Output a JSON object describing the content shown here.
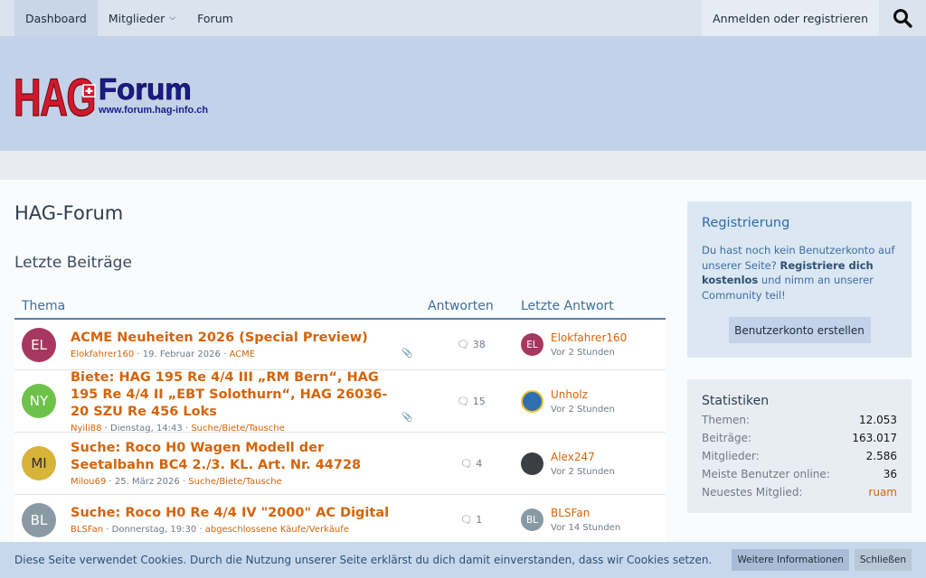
{
  "nav": {
    "items": [
      {
        "label": "Dashboard"
      },
      {
        "label": "Mitglieder"
      },
      {
        "label": "Forum"
      }
    ],
    "login_label": "Anmelden oder registrieren",
    "search_icon": "search-icon"
  },
  "logo": {
    "letters": "HAG",
    "word": "Forum",
    "url": "www.forum.hag-info.ch"
  },
  "page_title": "HAG-Forum",
  "section_title": "Letzte Beiträge",
  "table": {
    "col_thema": "Thema",
    "col_antworten": "Antworten",
    "col_letzte": "Letzte Antwort",
    "rows": [
      {
        "avatar": "EL",
        "avatar_color": "#a8375f",
        "title": "ACME Neuheiten 2026 (Special Preview)",
        "author": "Elokfahrer160",
        "date": "19. Februar 2026",
        "category": "ACME",
        "replies": "38",
        "last_avatar": "EL",
        "last_avatar_color": "#a8375f",
        "last_user": "Elokfahrer160",
        "last_time": "Vor 2 Stunden"
      },
      {
        "avatar": "NY",
        "avatar_color": "#6ec24a",
        "title": "Biete: HAG 195 Re 4/4 III „RM Bern“, HAG 195 Re 4/4 II „EBT Solothurn“, HAG 26036-20 SZU Re 456 Loks",
        "author": "Nyili88",
        "date": "Dienstag, 14:43",
        "category": "Suche/Biete/Tausche",
        "replies": "15",
        "last_avatar": "",
        "last_avatar_color": "#2e6fb0",
        "last_user": "Unholz",
        "last_time": "Vor 2 Stunden"
      },
      {
        "avatar": "MI",
        "avatar_color": "#d8b33a",
        "title": "Suche: Roco H0 Wagen Modell der Seetalbahn BC4 2./3. KL. Art. Nr. 44728",
        "author": "Milou69",
        "date": "25. März 2026",
        "category": "Suche/Biete/Tausche",
        "replies": "4",
        "last_avatar": "",
        "last_avatar_color": "#3b3f44",
        "last_user": "Alex247",
        "last_time": "Vor 2 Stunden"
      },
      {
        "avatar": "BL",
        "avatar_color": "#8a9aa5",
        "title": "Suche: Roco H0 Re 4/4 IV \"2000\" AC Digital",
        "author": "BLSFan",
        "date": "Donnerstag, 19:30",
        "category": "abgeschlossene Käufe/Verkäufe",
        "replies": "1",
        "last_avatar": "BL",
        "last_avatar_color": "#8a9aa5",
        "last_user": "BLSFan",
        "last_time": "Vor 14 Stunden"
      }
    ]
  },
  "registration": {
    "title": "Registrierung",
    "text_1": "Du hast noch kein Benutzerkonto auf unserer Seite? ",
    "text_bold": "Registriere dich kostenlos",
    "text_2": " und nimm an unserer Community teil!",
    "button": "Benutzerkonto erstellen"
  },
  "stats": {
    "title": "Statistiken",
    "rows": [
      {
        "label": "Themen:",
        "value": "12.053"
      },
      {
        "label": "Beiträge:",
        "value": "163.017"
      },
      {
        "label": "Mitglieder:",
        "value": "2.586"
      },
      {
        "label": "Meiste Benutzer online:",
        "value": "36"
      },
      {
        "label": "Neuestes Mitglied:",
        "value": "ruam"
      }
    ]
  },
  "cookie": {
    "text": "Diese Seite verwendet Cookies. Durch die Nutzung unserer Seite erklärst du dich damit einverstanden, dass wir Cookies setzen.",
    "more_label": "Weitere Informationen",
    "close_label": "Schließen"
  },
  "colors": {
    "accent": "#d4640a",
    "link_blue": "#3c6ea3",
    "header_bg": "#c3d2e8"
  }
}
